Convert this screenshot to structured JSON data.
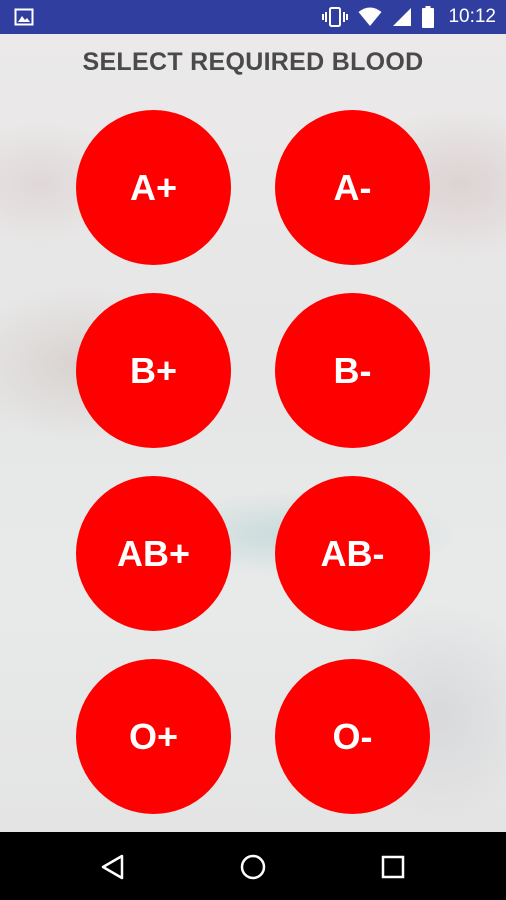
{
  "status_bar": {
    "time": "10:12",
    "icons": [
      "image-icon",
      "vibrate-icon",
      "wifi-icon",
      "cell-signal-icon",
      "battery-icon"
    ]
  },
  "screen": {
    "title": "SELECT REQUIRED BLOOD"
  },
  "blood_groups": [
    {
      "label": "A+"
    },
    {
      "label": "A-"
    },
    {
      "label": "B+"
    },
    {
      "label": "B-"
    },
    {
      "label": "AB+"
    },
    {
      "label": "AB-"
    },
    {
      "label": "O+"
    },
    {
      "label": "O-"
    }
  ],
  "nav_bar": {
    "icons": [
      "back-icon",
      "home-icon",
      "recent-apps-icon"
    ]
  },
  "colors": {
    "status_bar": "#303f9f",
    "button": "#ff0000",
    "button_text": "#ffffff",
    "title_text": "#4a4a4a"
  }
}
